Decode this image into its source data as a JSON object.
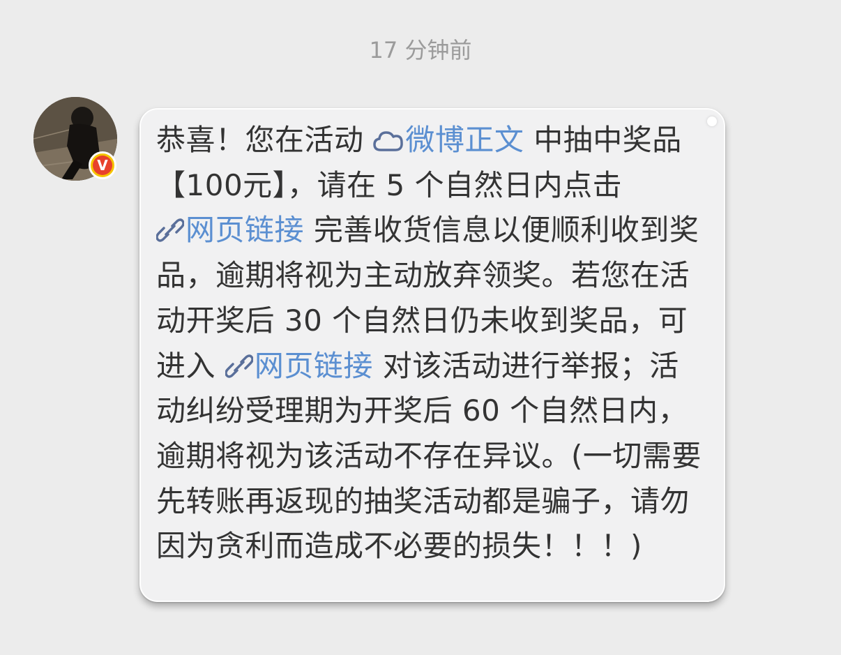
{
  "timestamp": "17 分钟前",
  "colors": {
    "background": "#ececec",
    "bubble": "#f1f1f2",
    "text": "#333333",
    "link": "#5b8fd1",
    "badge_outer": "#f5c400",
    "badge_inner": "#e8412c"
  },
  "sender": {
    "avatar_icon": "user-avatar",
    "verified_badge": "V"
  },
  "message": {
    "part1": "恭喜！您在活动 ",
    "link1": {
      "icon": "cloud-icon",
      "label": "微博正文"
    },
    "part2": " 中抽中奖品【100元】，请在 5 个自然日内点击 ",
    "link2": {
      "icon": "link-icon",
      "label": "网页链接"
    },
    "part3": " 完善收货信息以便顺利收到奖品，逾期将视为主动放弃领奖。若您在活动开奖后 30 个自然日仍未收到奖品，可进入 ",
    "link3": {
      "icon": "link-icon",
      "label": "网页链接"
    },
    "part4": " 对该活动进行举报；活动纠纷受理期为开奖后 60 个自然日内，逾期将视为该活动不存在异议。(一切需要先转账再返现的抽奖活动都是骗子，请勿因为贪利而造成不必要的损失！！！)"
  }
}
